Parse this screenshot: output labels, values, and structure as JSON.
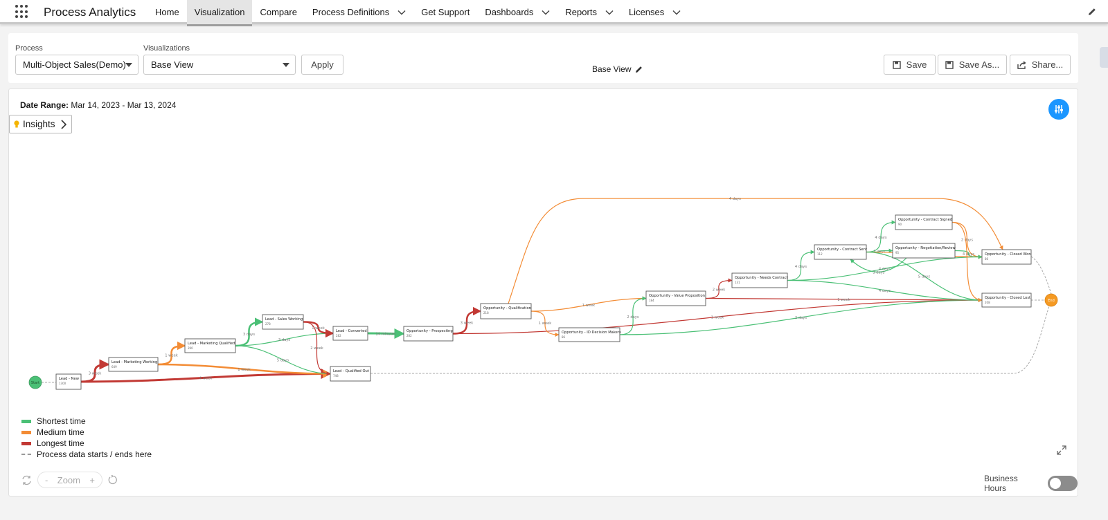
{
  "app": {
    "name": "Process Analytics"
  },
  "nav": {
    "items": [
      {
        "label": "Home",
        "dropdown": false,
        "active": false
      },
      {
        "label": "Visualization",
        "dropdown": false,
        "active": true
      },
      {
        "label": "Compare",
        "dropdown": false,
        "active": false
      },
      {
        "label": "Process Definitions",
        "dropdown": true,
        "active": false
      },
      {
        "label": "Get Support",
        "dropdown": false,
        "active": false
      },
      {
        "label": "Dashboards",
        "dropdown": true,
        "active": false
      },
      {
        "label": "Reports",
        "dropdown": true,
        "active": false
      },
      {
        "label": "Licenses",
        "dropdown": true,
        "active": false
      }
    ]
  },
  "controls": {
    "process_label": "Process",
    "process_value": "Multi-Object Sales(Demo)",
    "visualizations_label": "Visualizations",
    "visualizations_value": "Base View",
    "apply_label": "Apply",
    "view_name": "Base View",
    "save_label": "Save",
    "save_as_label": "Save As...",
    "share_label": "Share..."
  },
  "card": {
    "date_range_label": "Date Range:",
    "date_range_value": "Mar 14, 2023 - Mar 13, 2024",
    "insights_label": "Insights"
  },
  "legend": {
    "shortest": "Shortest time",
    "medium": "Medium time",
    "longest": "Longest time",
    "dashed": "Process data starts / ends here"
  },
  "zoom": {
    "minus": "-",
    "label": "Zoom",
    "plus": "+"
  },
  "business_hours": {
    "label": "Business Hours",
    "enabled": false
  },
  "colors": {
    "shortest": "#4bc076",
    "medium": "#f38c35",
    "longest": "#c23934",
    "accent": "#1b96ff",
    "end_node": "#f59a23",
    "start_node": "#4bc076"
  },
  "graph": {
    "start_label": "Start",
    "end_label": "End",
    "nodes": [
      {
        "id": "new",
        "label": "Lead - New",
        "count": "1300"
      },
      {
        "id": "mw",
        "label": "Lead - Marketing Working",
        "count": "649"
      },
      {
        "id": "mq",
        "label": "Lead - Marketing Qualified",
        "count": "390"
      },
      {
        "id": "sw",
        "label": "Lead - Sales Working",
        "count": "278"
      },
      {
        "id": "conv",
        "label": "Lead - Converted",
        "count": "282"
      },
      {
        "id": "qo",
        "label": "Lead - Qualified Out",
        "count": "748"
      },
      {
        "id": "prosp",
        "label": "Opportunity - Prospecting",
        "count": "282"
      },
      {
        "id": "qual",
        "label": "Opportunity - Qualification",
        "count": "218"
      },
      {
        "id": "idm",
        "label": "Opportunity - ID Decision Makers",
        "count": "86"
      },
      {
        "id": "vp",
        "label": "Opportunity - Value Proposition",
        "count": "184"
      },
      {
        "id": "nc",
        "label": "Opportunity - Needs Contract",
        "count": "131"
      },
      {
        "id": "cs",
        "label": "Opportunity - Contract Sent",
        "count": "112"
      },
      {
        "id": "csg",
        "label": "Opportunity - Contract Signed",
        "count": "90"
      },
      {
        "id": "nr",
        "label": "Opportunity - Negotiation/Review",
        "count": "95"
      },
      {
        "id": "cw",
        "label": "Opportunity - Closed Won",
        "count": "86"
      },
      {
        "id": "cl",
        "label": "Opportunity - Closed Lost",
        "count": "208"
      }
    ],
    "edges": [
      {
        "from": "new",
        "to": "mw",
        "color": "longest",
        "label": "3 week",
        "w": 3
      },
      {
        "from": "new",
        "to": "qo",
        "color": "longest",
        "label": "4 week",
        "w": 3
      },
      {
        "from": "mw",
        "to": "mq",
        "color": "medium",
        "label": "1 week",
        "w": 2.5
      },
      {
        "from": "mw",
        "to": "qo",
        "color": "medium",
        "label": "1 week",
        "w": 2.5
      },
      {
        "from": "mq",
        "to": "sw",
        "color": "shortest",
        "label": "3 days",
        "w": 2.5
      },
      {
        "from": "mq",
        "to": "conv",
        "color": "shortest",
        "label": "3 days",
        "w": 1.2
      },
      {
        "from": "mq",
        "to": "qo",
        "color": "shortest",
        "label": "5 days",
        "w": 1.2
      },
      {
        "from": "sw",
        "to": "conv",
        "color": "longest",
        "label": "1 week",
        "w": 2.5
      },
      {
        "from": "sw",
        "to": "qo",
        "color": "longest",
        "label": "2 week",
        "w": 1.2
      },
      {
        "from": "conv",
        "to": "prosp",
        "color": "shortest",
        "label": "14 minutes",
        "w": 3
      },
      {
        "from": "prosp",
        "to": "qual",
        "color": "longest",
        "label": "3 week",
        "w": 2.5
      },
      {
        "from": "prosp",
        "to": "cl",
        "color": "longest",
        "label": "1 week",
        "w": 1.2
      },
      {
        "from": "qual",
        "to": "vp",
        "color": "medium",
        "label": "1 week",
        "w": 1.2
      },
      {
        "from": "qual",
        "to": "idm",
        "color": "medium",
        "label": "1 week",
        "w": 1.2
      },
      {
        "from": "qual",
        "to": "cw",
        "color": "medium",
        "label": "4 days",
        "w": 1.2
      },
      {
        "from": "idm",
        "to": "vp",
        "color": "shortest",
        "label": "2 days",
        "w": 1.2
      },
      {
        "from": "idm",
        "to": "cl",
        "color": "shortest",
        "label": "2 days",
        "w": 1.2
      },
      {
        "from": "vp",
        "to": "nc",
        "color": "longest",
        "label": "2 week",
        "w": 1.2
      },
      {
        "from": "vp",
        "to": "cl",
        "color": "longest",
        "label": "1 week",
        "w": 1.2
      },
      {
        "from": "nc",
        "to": "cs",
        "color": "shortest",
        "label": "4 days",
        "w": 1.2
      },
      {
        "from": "nc",
        "to": "cw",
        "color": "shortest",
        "label": "4 days",
        "w": 1.2
      },
      {
        "from": "nc",
        "to": "cl",
        "color": "shortest",
        "label": "4 days",
        "w": 1.2
      },
      {
        "from": "cs",
        "to": "csg",
        "color": "shortest",
        "label": "4 days",
        "w": 1.2
      },
      {
        "from": "cs",
        "to": "nr",
        "color": "shortest",
        "label": "5 days",
        "w": 1.2
      },
      {
        "from": "cs",
        "to": "cw",
        "color": "medium",
        "label": "4 days",
        "w": 1.2
      },
      {
        "from": "cs",
        "to": "cl",
        "color": "shortest",
        "label": "5 days",
        "w": 1.2
      },
      {
        "from": "nr",
        "to": "cs",
        "color": "shortest",
        "label": "3 days",
        "w": 1.2
      },
      {
        "from": "csg",
        "to": "cw",
        "color": "medium",
        "label": "2 days",
        "w": 1.2
      },
      {
        "from": "nr",
        "to": "cw",
        "color": "shortest",
        "label": "4 days",
        "w": 1.2
      },
      {
        "from": "csg",
        "to": "cl",
        "color": "medium",
        "label": "",
        "w": 1.2
      }
    ]
  }
}
